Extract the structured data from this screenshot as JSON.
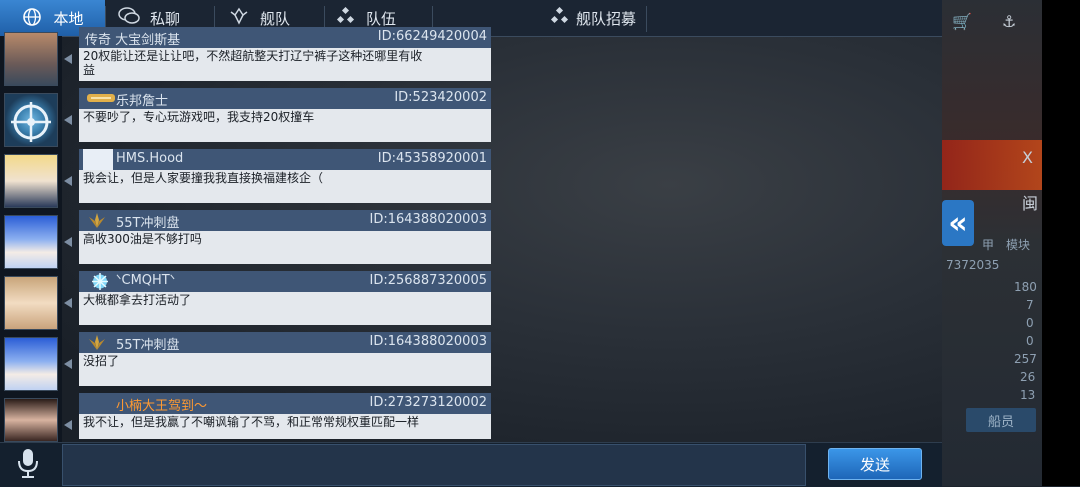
{
  "tabs": [
    {
      "label": "本地",
      "icon": "globe-icon",
      "active": true
    },
    {
      "label": "私聊",
      "icon": "chat-bubbles-icon",
      "active": false
    },
    {
      "label": "舰队",
      "icon": "fleet-emblem-icon",
      "active": false
    },
    {
      "label": "队伍",
      "icon": "team-dots-icon",
      "active": false
    },
    {
      "label": "舰队招募",
      "icon": "recruit-dots-icon",
      "active": false
    }
  ],
  "messages": [
    {
      "name": "传奇 大宝剑斯基",
      "uid": "ID:66249420004",
      "text": "20权能让还是让让吧，不然超航整天打辽宁裤子这种还哪里有收益"
    },
    {
      "name": "乐邦詹士",
      "uid": "ID:523420002",
      "text": "不要吵了，专心玩游戏吧，我支持20权撞车"
    },
    {
      "name": "HMS.Hood",
      "uid": "ID:45358920001",
      "text": "我会让，但是人家要撞我我直接换福建核企（"
    },
    {
      "name": "55T冲刺盘",
      "uid": "ID:164388020003",
      "text": "高收300油是不够打吗"
    },
    {
      "name": "ᐠCMQHTᐠ",
      "uid": "ID:256887320005",
      "text": "大概都拿去打活动了"
    },
    {
      "name": "55T冲刺盘",
      "uid": "ID:164388020003",
      "text": "没招了"
    },
    {
      "name": "小楠大王驾到〜",
      "uid": "ID:273273120002",
      "text": "我不让，但是我赢了不嘲讽输了不骂，和正常常规权重匹配一样"
    }
  ],
  "composer": {
    "send_label": "发送"
  },
  "side_panel": {
    "expand_glyph": "«",
    "crew_label": "船员",
    "id_fragment": "7372035",
    "stat_values": [
      "180",
      "7",
      "0",
      "0",
      "257",
      "26",
      "13"
    ],
    "char_x": "X",
    "char_lan": "闽",
    "char_a": "甲",
    "char_b": "模块"
  },
  "colors": {
    "active_tab": "#2f7dcb",
    "header": "#3f5676",
    "body": "#e4e8ed",
    "orange_name": "#ff9a32"
  }
}
